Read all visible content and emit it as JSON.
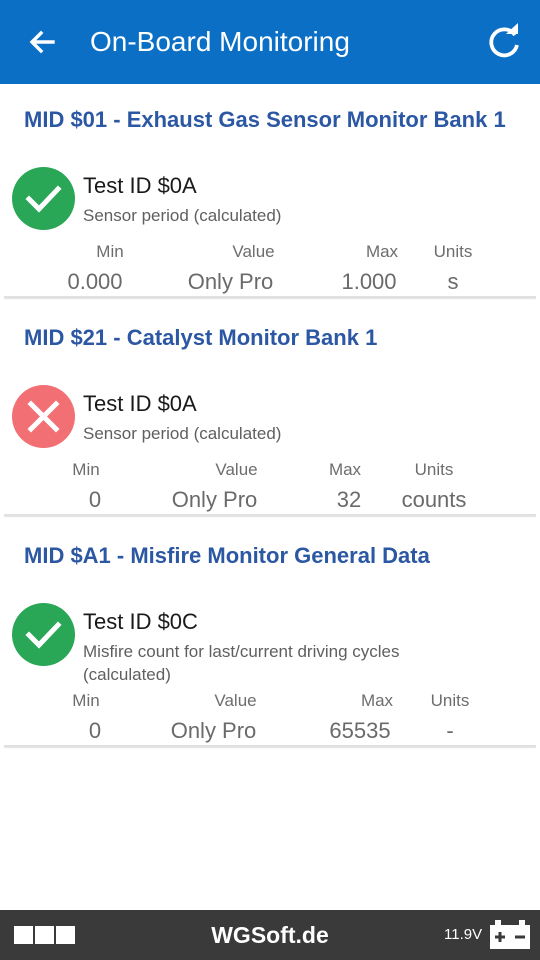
{
  "app_bar": {
    "title": "On-Board Monitoring",
    "back_icon": "arrow-left-icon",
    "refresh_icon": "refresh-icon",
    "background_color": "#0b6fc6"
  },
  "monitors": [
    {
      "mid_title": "MID $01 - Exhaust Gas Sensor Monitor Bank 1",
      "status": "pass",
      "status_icon": "check-icon",
      "test_id": "Test ID $0A",
      "description": "Sensor period (calculated)",
      "headers": {
        "min": "Min",
        "value": "Value",
        "max": "Max",
        "units": "Units"
      },
      "values": {
        "min": "0.000",
        "value": "Only Pro",
        "max": "1.000",
        "units": "s"
      }
    },
    {
      "mid_title": "MID $21 - Catalyst Monitor Bank 1",
      "status": "fail",
      "status_icon": "close-icon",
      "test_id": "Test ID $0A",
      "description": "Sensor period (calculated)",
      "headers": {
        "min": "Min",
        "value": "Value",
        "max": "Max",
        "units": "Units"
      },
      "values": {
        "min": "0",
        "value": "Only Pro",
        "max": "32",
        "units": "counts"
      }
    },
    {
      "mid_title": "MID $A1 - Misfire Monitor General Data",
      "status": "pass",
      "status_icon": "check-icon",
      "test_id": "Test ID $0C",
      "description": "Misfire count for last/current driving cycles (calculated)",
      "headers": {
        "min": "Min",
        "value": "Value",
        "max": "Max",
        "units": "Units"
      },
      "values": {
        "min": "0",
        "value": "Only Pro",
        "max": "65535",
        "units": "-"
      }
    }
  ],
  "bottom_bar": {
    "brand": "WGSoft.de",
    "voltage": "11.9V",
    "battery_icon": "battery-icon",
    "menu_icon": "three-squares-icon"
  },
  "colors": {
    "pass": "#2aa657",
    "fail": "#f26f73",
    "mid_title": "#2b57a3"
  }
}
